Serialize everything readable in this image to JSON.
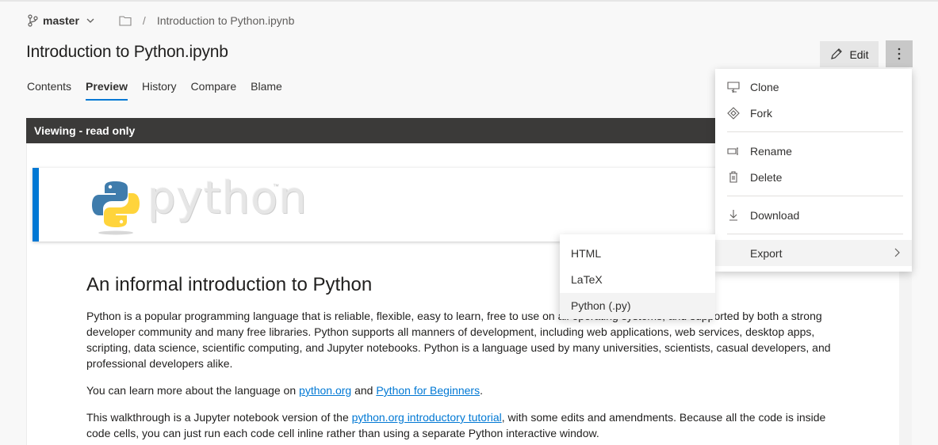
{
  "breadcrumb": {
    "branch": "master",
    "separator": "/",
    "file": "Introduction to Python.ipynb"
  },
  "page": {
    "title": "Introduction to Python.ipynb"
  },
  "tabs": [
    {
      "label": "Contents"
    },
    {
      "label": "Preview",
      "active": true
    },
    {
      "label": "History"
    },
    {
      "label": "Compare"
    },
    {
      "label": "Blame"
    }
  ],
  "toolbar": {
    "edit_label": "Edit",
    "edit_icon": "pencil-icon",
    "more_icon": "more-vertical-icon"
  },
  "viewer": {
    "status": "Viewing - read only"
  },
  "logo": {
    "word": "python",
    "tm": "™"
  },
  "notebook": {
    "heading": "An informal introduction to Python",
    "p1": "Python is a popular programming language that is reliable, flexible, easy to learn, free to use on all operating systems, and supported by both a strong developer community and many free libraries. Python supports all manners of development, including web applications, web services, desktop apps, scripting, data science, scientific computing, and Jupyter notebooks. Python is a language used by many universities, scientists, casual developers, and professional developers alike.",
    "p2_pre": "You can learn more about the language on ",
    "p2_link1": "python.org",
    "p2_mid": " and ",
    "p2_link2": "Python for Beginners",
    "p2_post": ".",
    "p3_pre": "This walkthrough is a Jupyter notebook version of the ",
    "p3_link": "python.org introductory tutorial",
    "p3_post": ", with some edits and amendments. Because all the code is inside code cells, you can just run each code cell inline rather than using a separate Python interactive window."
  },
  "menu": {
    "items": [
      {
        "label": "Clone",
        "icon": "clone-icon"
      },
      {
        "label": "Fork",
        "icon": "fork-icon"
      },
      {
        "label": "Rename",
        "icon": "rename-icon"
      },
      {
        "label": "Delete",
        "icon": "trash-icon"
      },
      {
        "label": "Download",
        "icon": "download-icon"
      },
      {
        "label": "Export",
        "icon": "chevron-right-icon"
      }
    ]
  },
  "export_menu": {
    "items": [
      {
        "label": "HTML"
      },
      {
        "label": "LaTeX"
      },
      {
        "label": "Python (.py)"
      }
    ]
  },
  "colors": {
    "accent": "#0078d4",
    "header_bar": "#3b3a39",
    "python_blue": "#3f7cac",
    "python_yellow": "#ffd43b"
  }
}
